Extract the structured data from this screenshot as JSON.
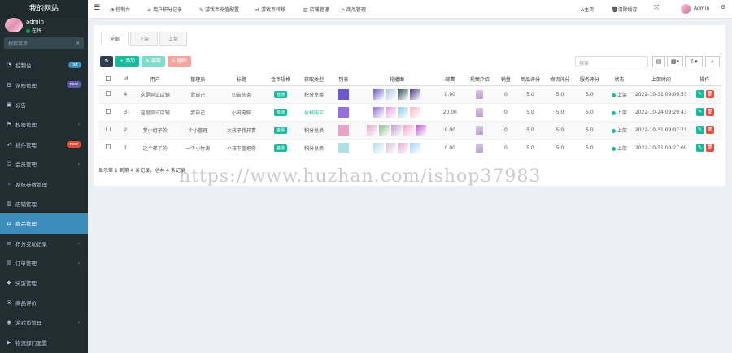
{
  "brand": "我的网站",
  "user": {
    "name": "admin",
    "status": "在线"
  },
  "sidebar": {
    "search_placeholder": "搜索菜单",
    "items": [
      {
        "label": "控制台",
        "icon": "dashboard-icon",
        "badge": "hot",
        "badge_color": "#3c8dbc"
      },
      {
        "label": "常规管理",
        "icon": "cogs-icon",
        "badge": "new",
        "badge_color": "#605ca8"
      },
      {
        "label": "公告",
        "icon": "notice-icon"
      },
      {
        "label": "权限管理",
        "icon": "group-icon",
        "arrow": true
      },
      {
        "label": "插件管理",
        "icon": "rocket-icon",
        "badge": "new",
        "badge_color": "#dd4b39"
      },
      {
        "label": "会员管理",
        "icon": "user-icon",
        "arrow": true
      },
      {
        "label": "系统参数管理",
        "icon": "chevron-right-icon"
      },
      {
        "label": "店铺管理",
        "icon": "store-icon"
      },
      {
        "label": "商品管理",
        "icon": "shop-icon",
        "active": true
      },
      {
        "label": "积分变动记录",
        "icon": "list-icon",
        "arrow": true
      },
      {
        "label": "订单管理",
        "icon": "order-icon",
        "arrow": true
      },
      {
        "label": "类型管理",
        "icon": "tag-icon"
      },
      {
        "label": "商品评价",
        "icon": "comment-icon"
      },
      {
        "label": "游戏币管理",
        "icon": "coin-icon",
        "arrow": true
      },
      {
        "label": "物流部门配置",
        "icon": "truck-icon"
      }
    ]
  },
  "topnav": {
    "items": [
      {
        "label": "控制台",
        "icon": "dashboard-icon"
      },
      {
        "label": "用户积分记录",
        "icon": "list-icon"
      },
      {
        "label": "游戏币充值配置",
        "icon": "edit-icon"
      },
      {
        "label": "游戏币转移",
        "icon": "exchange-icon"
      },
      {
        "label": "店铺管理",
        "icon": "store-icon"
      },
      {
        "label": "商品管理",
        "icon": "shop-icon"
      }
    ],
    "home": "主页",
    "clear_cache": "清除缓存",
    "admin": "Admin"
  },
  "tabs": [
    "全部",
    "下架",
    "上架"
  ],
  "toolbar": {
    "add": "添加",
    "edit": "编辑",
    "delete": "删除"
  },
  "search_placeholder": "搜索",
  "table": {
    "headers": [
      "Id",
      "用户",
      "管理员",
      "标题",
      "金币规格",
      "获取类型",
      "列表",
      "轮播图",
      "邮费",
      "视频介绍",
      "销量",
      "商品评分",
      "物流评分",
      "服务评分",
      "状态",
      "上架时间",
      "操作"
    ],
    "rows": [
      {
        "id": "4",
        "user": "这是测试店铺",
        "admin": "我自己",
        "title": "切苦头条",
        "coin": "普通",
        "type": "积分兑换",
        "type_color": "#555",
        "images": [
          "#6a5acd",
          "#b0c4de",
          "#2f4f4f",
          "#483d8b"
        ],
        "postage": "0.00",
        "sales": "0",
        "rate1": "5.0",
        "rate2": "5.0",
        "rate3": "5.0",
        "status": "上架",
        "time": "2022-10-31 09:09:53"
      },
      {
        "id": "3",
        "user": "这是测试店铺",
        "admin": "我自己",
        "title": "小说电脑",
        "coin": "金融",
        "type": "价格购买",
        "type_color": "#18bc9c",
        "images": [
          "#9370db",
          "#dda0dd",
          "#87ceeb",
          "#ffb6c1"
        ],
        "postage": "20.00",
        "sales": "0",
        "rate1": "5.0",
        "rate2": "5.0",
        "rate3": "5.0",
        "status": "上架",
        "time": "2022-10-24 09:29:43"
      },
      {
        "id": "2",
        "user": "梦小姐子的",
        "admin": "个小管理",
        "title": "大孩子我开青",
        "coin": "金融",
        "type": "积分兑换",
        "type_color": "#555",
        "images": [
          "#e9a3c9",
          "#8fbc8f",
          "#c39bd3",
          "#f4a6c7",
          "#ba55d3"
        ],
        "postage": "0.00",
        "sales": "0",
        "rate1": "5.0",
        "rate2": "5.0",
        "rate3": "5.0",
        "status": "上架",
        "time": "2022-10-31 09:07:21"
      },
      {
        "id": "1",
        "user": "这个梯了的",
        "admin": "一个小竹涛",
        "title": "小孩下盖把你",
        "coin": "金融",
        "type": "积分兑换",
        "type_color": "#555",
        "images": [
          "#b0e0e6",
          "#d8bfd8",
          "#e6a8d7",
          "#a2d2ff"
        ],
        "postage": "0.00",
        "sales": "0",
        "rate1": "5.0",
        "rate2": "5.0",
        "rate3": "5.0",
        "status": "上架",
        "time": "2022-10-31 09:27:09"
      }
    ]
  },
  "pager": "显示第 1 到第 4 条记录，总共 4 条记录",
  "watermark": "https://www.huzhan.com/ishop37983",
  "colors": {
    "primary": "#3c8dbc",
    "success": "#18bc9c",
    "danger": "#e74c3c",
    "warning": "#f39c12",
    "sidebar": "#222d32"
  }
}
